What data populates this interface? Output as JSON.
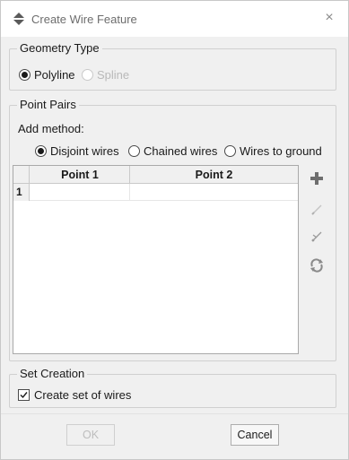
{
  "window": {
    "title": "Create Wire Feature",
    "close_glyph": "×"
  },
  "geometry_type": {
    "title": "Geometry Type",
    "options": [
      {
        "label": "Polyline",
        "selected": true,
        "enabled": true
      },
      {
        "label": "Spline",
        "selected": false,
        "enabled": false
      }
    ]
  },
  "point_pairs": {
    "title": "Point Pairs",
    "add_method_label": "Add method:",
    "methods": [
      {
        "label": "Disjoint wires",
        "selected": true
      },
      {
        "label": "Chained wires",
        "selected": false
      },
      {
        "label": "Wires to ground",
        "selected": false
      }
    ],
    "table": {
      "columns": [
        "Point 1",
        "Point 2"
      ],
      "rows": [
        {
          "index": "1",
          "cells": [
            "",
            ""
          ]
        }
      ]
    },
    "side_buttons": [
      "plus-icon",
      "pencil-icon",
      "pick-icon",
      "refresh-icon"
    ]
  },
  "set_creation": {
    "title": "Set Creation",
    "checkbox_label": "Create set of wires",
    "checked": true
  },
  "buttons": {
    "ok": "OK",
    "cancel": "Cancel"
  },
  "colors": {
    "dialog_bg": "#f0f0f0",
    "plus_icon": "#6e6e6e",
    "disabled_text": "#bdbdbd"
  }
}
